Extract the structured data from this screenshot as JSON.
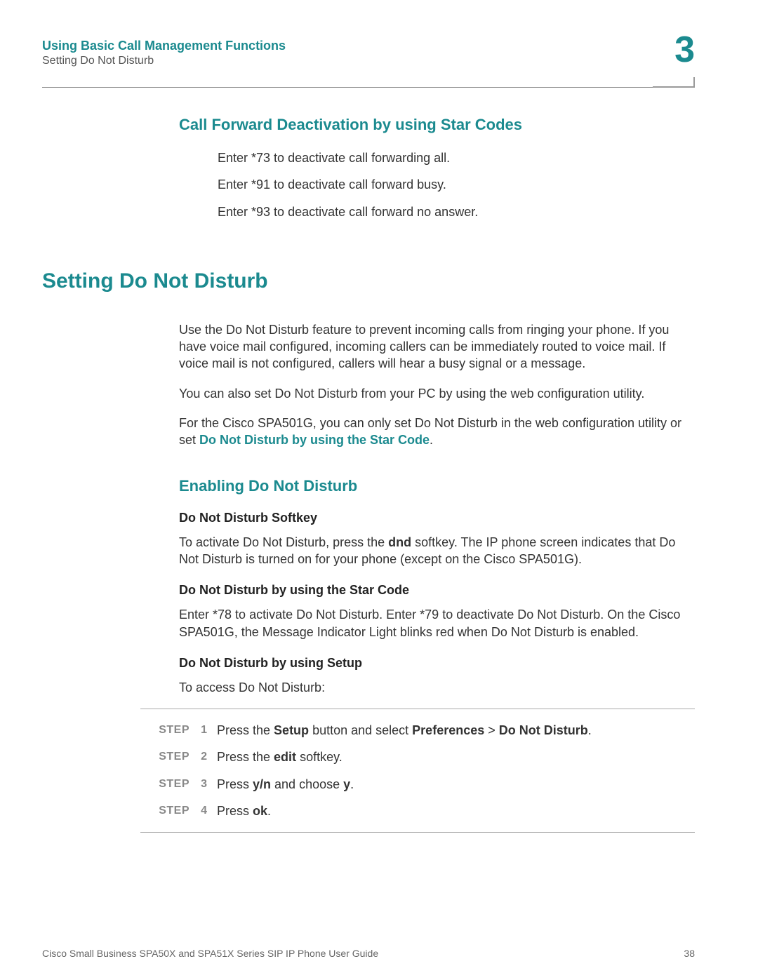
{
  "header": {
    "chapter_title": "Using Basic Call Management Functions",
    "section_title": "Setting Do Not Disturb",
    "chapter_number": "3"
  },
  "sec_cf_deact": {
    "title": "Call Forward Deactivation by using Star Codes",
    "lines": [
      "Enter *73 to deactivate call forwarding all.",
      "Enter *91 to deactivate call forward busy.",
      "Enter *93 to deactivate call forward no answer."
    ]
  },
  "sec_dnd": {
    "title": "Setting Do Not Disturb",
    "p1": "Use the Do Not Disturb feature to prevent incoming calls from ringing your phone. If you have voice mail configured, incoming callers can be immediately routed to voice mail. If voice mail is not configured, callers will hear a busy signal or a message.",
    "p2": "You can also set Do Not Disturb from your PC by using the web configuration utility.",
    "p3a": "For the Cisco SPA501G, you can only set Do Not Disturb in the web configuration utility or set ",
    "p3_link": "Do Not Disturb by using the Star Code",
    "p3b": "."
  },
  "sec_enable": {
    "title": "Enabling Do Not Disturb",
    "softkey": {
      "title": "Do Not Disturb Softkey",
      "p_a": "To activate Do Not Disturb, press the ",
      "p_bold": "dnd",
      "p_b": " softkey. The IP phone screen indicates that Do Not Disturb is turned on for your phone (except on the Cisco SPA501G)."
    },
    "star": {
      "title": "Do Not Disturb by using the Star Code",
      "p": "Enter *78 to activate Do Not Disturb. Enter *79 to deactivate Do Not Disturb. On the Cisco SPA501G, the Message Indicator Light blinks red when Do Not Disturb is enabled."
    },
    "setup": {
      "title": "Do Not Disturb by using Setup",
      "intro": "To access Do Not Disturb:"
    }
  },
  "steps": [
    {
      "label": "STEP",
      "num": "1",
      "pre": "Press the ",
      "b1": "Setup",
      "mid": " button and select ",
      "b2": "Preferences",
      "sep": " > ",
      "b3": "Do Not Disturb",
      "post": "."
    },
    {
      "label": "STEP",
      "num": "2",
      "pre": "Press the ",
      "b1": "edit",
      "mid": " softkey.",
      "b2": "",
      "sep": "",
      "b3": "",
      "post": ""
    },
    {
      "label": "STEP",
      "num": "3",
      "pre": "Press ",
      "b1": "y/n",
      "mid": " and choose ",
      "b2": "y",
      "sep": "",
      "b3": "",
      "post": "."
    },
    {
      "label": "STEP",
      "num": "4",
      "pre": "Press ",
      "b1": "ok",
      "mid": ".",
      "b2": "",
      "sep": "",
      "b3": "",
      "post": ""
    }
  ],
  "footer": {
    "doc": "Cisco Small Business SPA50X and SPA51X Series SIP IP Phone User Guide",
    "page": "38"
  }
}
